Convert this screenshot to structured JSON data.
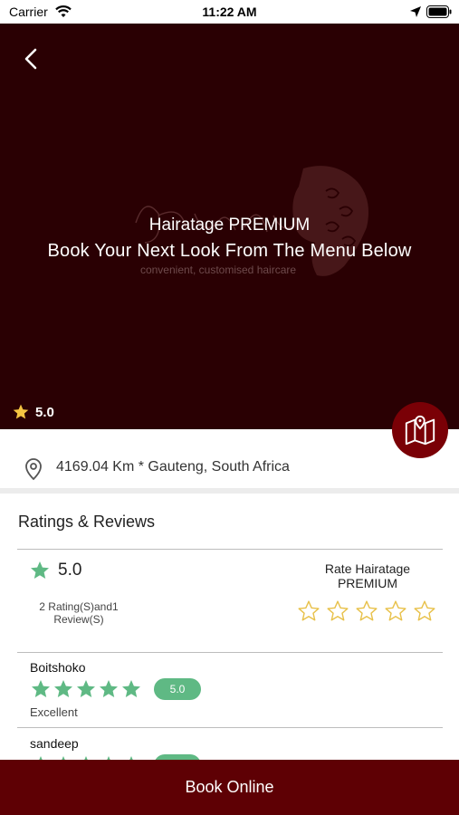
{
  "status_bar": {
    "carrier": "Carrier",
    "time": "11:22 AM"
  },
  "hero": {
    "title": "Hairatage PREMIUM",
    "subtitle": "Book Your Next Look From The Menu Below",
    "tagline": "convenient, customised haircare",
    "rating": "5.0",
    "background_color": "#2a0003"
  },
  "address": {
    "text": "4169.04 Km * Gauteng, South Africa"
  },
  "reviews_section": {
    "heading": "Ratings & Reviews",
    "summary_rating": "5.0",
    "summary_count_line1": "2 Rating(S)and1",
    "summary_count_line2": "Review(S)",
    "rate_label_line1": "Rate Hairatage",
    "rate_label_line2": "PREMIUM",
    "rate_star_count": 5
  },
  "reviews": [
    {
      "name": "Boitshoko",
      "stars": 5,
      "score": "5.0",
      "comment": "Excellent"
    },
    {
      "name": "sandeep",
      "stars": 5,
      "score": "5.0",
      "comment": ""
    }
  ],
  "book_button": {
    "label": "Book Online",
    "color": "#5e0004"
  },
  "colors": {
    "accent_green": "#5fb984",
    "gold_star": "#f5c542",
    "outline_star": "#e8c14a"
  },
  "icons": {
    "back": "chevron-left-icon",
    "map": "map-pin-icon",
    "location": "location-pin-icon",
    "star": "star-icon"
  }
}
